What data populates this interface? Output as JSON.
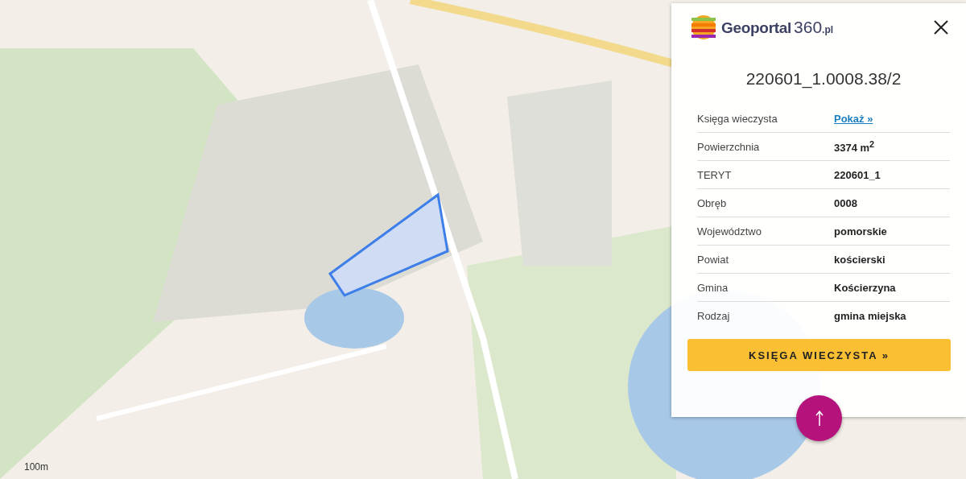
{
  "map": {
    "scale_label": "100m"
  },
  "panel": {
    "logo": {
      "name": "Geoportal",
      "number": "360",
      "suffix": ".pl"
    },
    "title": "220601_1.0008.38/2",
    "rows": [
      {
        "label": "Księga wieczysta",
        "value": "Pokaż »",
        "kind": "link"
      },
      {
        "label": "Powierzchnia",
        "value": "3374 m$^{2}$",
        "kind": "text"
      },
      {
        "label": "TERYT",
        "value": "220601_1",
        "kind": "text"
      },
      {
        "label": "Obręb",
        "value": "0008",
        "kind": "text"
      },
      {
        "label": "Województwo",
        "value": "pomorskie",
        "kind": "text"
      },
      {
        "label": "Powiat",
        "value": "kościerski",
        "kind": "text"
      },
      {
        "label": "Gmina",
        "value": "Kościerzyna",
        "kind": "text"
      },
      {
        "label": "Rodzaj",
        "value": "gmina miejska",
        "kind": "text"
      }
    ],
    "button": "KSIĘGA WIECZYSTA »"
  }
}
